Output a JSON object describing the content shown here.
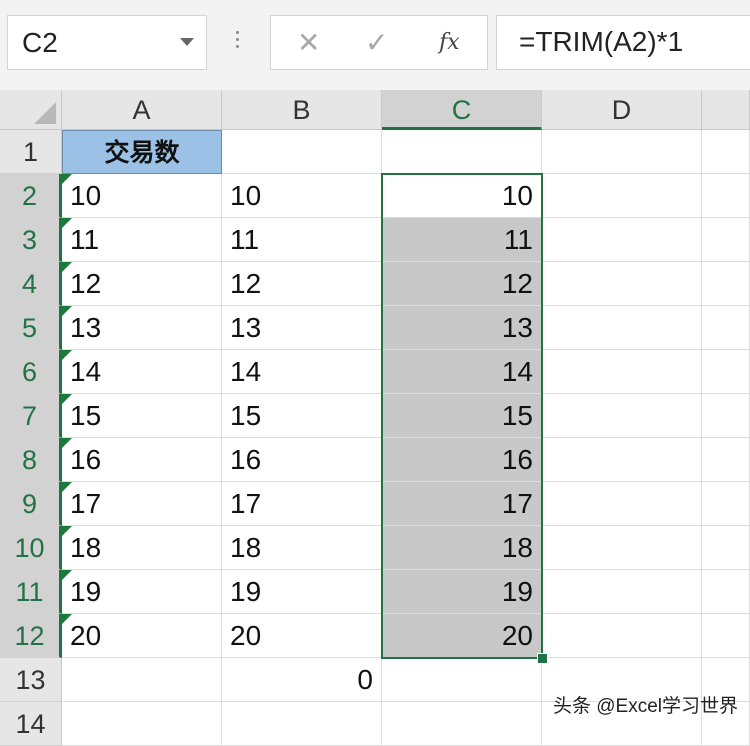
{
  "name_box": {
    "value": "C2"
  },
  "formula_bar": {
    "cancel_icon": "✕",
    "enter_icon": "✓",
    "fx_label": "fx",
    "formula": "=TRIM(A2)*1"
  },
  "columns": [
    "A",
    "B",
    "C",
    "D"
  ],
  "selected_column": "C",
  "rows": [
    {
      "num": "1",
      "a": "交易数",
      "b": "",
      "c": ""
    },
    {
      "num": "2",
      "a": "10",
      "b": "10",
      "c": "10"
    },
    {
      "num": "3",
      "a": "11",
      "b": "11",
      "c": "11"
    },
    {
      "num": "4",
      "a": "12",
      "b": "12",
      "c": "12"
    },
    {
      "num": "5",
      "a": "13",
      "b": "13",
      "c": "13"
    },
    {
      "num": "6",
      "a": "14",
      "b": "14",
      "c": "14"
    },
    {
      "num": "7",
      "a": "15",
      "b": "15",
      "c": "15"
    },
    {
      "num": "8",
      "a": "16",
      "b": "16",
      "c": "16"
    },
    {
      "num": "9",
      "a": "17",
      "b": "17",
      "c": "17"
    },
    {
      "num": "10",
      "a": "18",
      "b": "18",
      "c": "18"
    },
    {
      "num": "11",
      "a": "19",
      "b": "19",
      "c": "19"
    },
    {
      "num": "12",
      "a": "20",
      "b": "20",
      "c": "20"
    },
    {
      "num": "13",
      "a": "",
      "b": "0",
      "c": ""
    },
    {
      "num": "14",
      "a": "",
      "b": "",
      "c": ""
    }
  ],
  "watermark": "头条 @Excel学习世界",
  "colors": {
    "accent": "#217346",
    "header_fill": "#9bc2e6",
    "selection_fill": "#c8c8c8"
  }
}
